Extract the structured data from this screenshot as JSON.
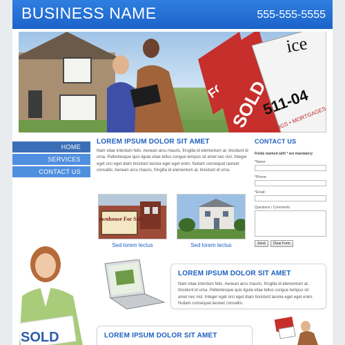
{
  "header": {
    "business_name": "BUSINESS NAME",
    "phone": "555-555-5555"
  },
  "hero": {
    "sign_for_sale": "FOR SALE",
    "sign_sold": "SOLD",
    "sign_office": "ice",
    "sign_phone": "511-04",
    "sign_tagline": "SETTINGS • MORTGAGES"
  },
  "nav": {
    "items": [
      {
        "label": "HOME",
        "active": true
      },
      {
        "label": "SERVICES",
        "active": false
      },
      {
        "label": "CONTACT US",
        "active": false
      }
    ]
  },
  "main": {
    "title": "LOREM IPSUM DOLOR SIT AMET",
    "text": "Nam vitae interdum felis. Aenean arcu mauris, fringilla id elementum at, tincidunt id urna. Pellentesque quis ligula vitae tellus congue tempus sit amet nec nisl. Integer eget orci eget diam tincidunt lacinia eget eget enim. Nullam consequat laoreet convallis. Aenean arcu mauris, fringilla id elementum at, tincidunt id urna.",
    "thumbs": [
      {
        "caption": "Sed lorem lectus",
        "sign": "Townhouse For Sale"
      },
      {
        "caption": "Sed lorem lectus"
      }
    ]
  },
  "card1": {
    "title": "LOREM IPSUM DOLOR SIT AMET",
    "text": "Nam vitae interdum felis. Aenean arcu mauris, fringilla id elementum at, tincidunt id urna. Pellentesque quis ligula vitae tellus congue tempus sit amet nec nisl. Integer eget orci eget diam tincidunt lacinia eget eget enim. Nullam consequat laoreet convallis."
  },
  "card2": {
    "title": "LOREM IPSUM DOLOR SIT AMET"
  },
  "side_photo": {
    "sign_text": "SOLD"
  },
  "contact": {
    "title": "CONTACT US",
    "mandatory": "Fields marked with * are mandatory",
    "name_label": "*Name:",
    "phone_label": "*Phone:",
    "email_label": "*Email:",
    "comments_label": "Questions / Comments:",
    "send_label": "Send",
    "clear_label": "Clear Form"
  },
  "colors": {
    "brand_blue": "#1c63c9",
    "nav_blue": "#4f8fe0",
    "nav_active": "#3a6fb8",
    "title_blue": "#1c5fc1"
  }
}
